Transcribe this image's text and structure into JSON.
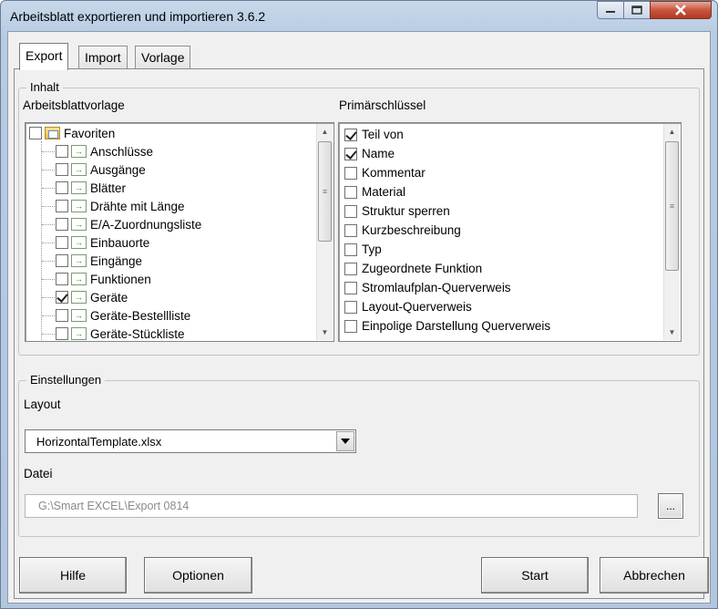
{
  "window": {
    "title": "Arbeitsblatt exportieren und importieren 3.6.2"
  },
  "tabs": [
    {
      "label": "Export"
    },
    {
      "label": "Import"
    },
    {
      "label": "Vorlage"
    }
  ],
  "content_group": {
    "legend": "Inhalt",
    "template_label": "Arbeitsblattvorlage",
    "primary_key_label": "Primärschlüssel",
    "tree": {
      "root": {
        "label": "Favoriten",
        "checked": false
      },
      "items": [
        {
          "label": "Anschlüsse",
          "checked": false
        },
        {
          "label": "Ausgänge",
          "checked": false
        },
        {
          "label": "Blätter",
          "checked": false
        },
        {
          "label": "Drähte mit Länge",
          "checked": false
        },
        {
          "label": "E/A-Zuordnungsliste",
          "checked": false
        },
        {
          "label": "Einbauorte",
          "checked": false
        },
        {
          "label": "Eingänge",
          "checked": false
        },
        {
          "label": "Funktionen",
          "checked": false
        },
        {
          "label": "Geräte",
          "checked": true
        },
        {
          "label": "Geräte-Bestellliste",
          "checked": false
        },
        {
          "label": "Geräte-Stückliste",
          "checked": false
        }
      ]
    },
    "primary_keys": [
      {
        "label": "Teil von",
        "checked": true
      },
      {
        "label": "Name",
        "checked": true
      },
      {
        "label": "Kommentar",
        "checked": false
      },
      {
        "label": "Material",
        "checked": false
      },
      {
        "label": "Struktur sperren",
        "checked": false
      },
      {
        "label": "Kurzbeschreibung",
        "checked": false
      },
      {
        "label": "Typ",
        "checked": false
      },
      {
        "label": "Zugeordnete Funktion",
        "checked": false
      },
      {
        "label": "Stromlaufplan-Querverweis",
        "checked": false
      },
      {
        "label": "Layout-Querverweis",
        "checked": false
      },
      {
        "label": "Einpolige Darstellung Querverweis",
        "checked": false
      }
    ]
  },
  "settings_group": {
    "legend": "Einstellungen",
    "layout_label": "Layout",
    "layout_value": "HorizontalTemplate.xlsx",
    "file_label": "Datei",
    "file_value": "G:\\Smart EXCEL\\Export 0814",
    "browse_label": "..."
  },
  "buttons": {
    "help": "Hilfe",
    "options": "Optionen",
    "start": "Start",
    "cancel": "Abbrechen"
  }
}
